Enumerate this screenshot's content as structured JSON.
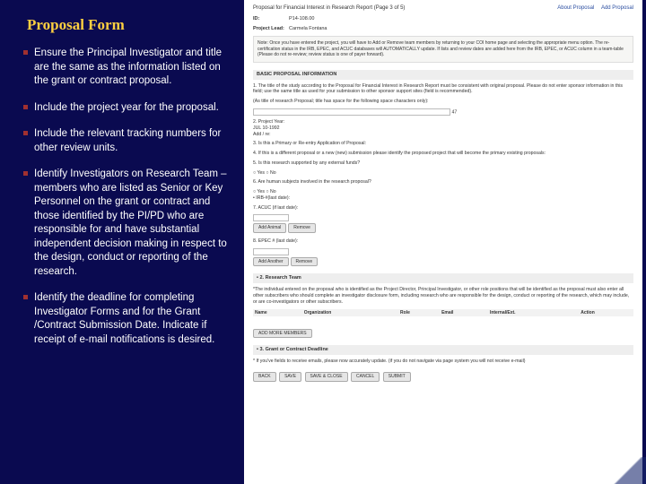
{
  "title": "Proposal Form",
  "bullets": [
    "Ensure the Principal Investigator and title are the same as the information listed on the grant or contract proposal.",
    "Include the project year for the proposal.",
    "Include the relevant tracking numbers for other review units.",
    "Identify Investigators on Research Team – members who are listed as Senior or Key Personnel on the grant or contract and those identified by the PI/PD who are responsible for and have substantial independent decision making in respect to the design, conduct or reporting of the research.",
    "Identify the deadline for completing Investigator Forms and for the Grant /Contract Submission Date. Indicate if receipt of e-mail notifications is desired."
  ],
  "form": {
    "page_title": "Proposal for Financial Interest in Research Report (Page 3 of 5)",
    "link_about": "About Proposal",
    "link_add": "Add Proposal",
    "id_label": "ID:",
    "id_value": "P14-108.00",
    "pi_label": "Project Lead:",
    "pi_value": "Carmela Fontana",
    "note": "Note: Once you have entered the project, you will have to Add or Remove team members by returning to your COI home page and selecting the appropriate menu option. The re-certification status in the IRB, EPEC, and ACUC databases will AUTOMATICALLY update. If lists and review dates are added here from the IRB, EPEC, or ACUC column in a team-table (Please do not re-review; review status is one of payer forward).",
    "box_basic": "BASIC PROPOSAL INFORMATION",
    "q1": "1. The title of the study according to the Proposal for Financial Interest in Research Report must be consistent with original proposal. Please do not enter sponsor information in this field; use the same title as used for your submission to other sponsor support sites (field is recommended).",
    "q1_hint": "(As title of research Proposal; title has space for the following space characters only):",
    "q2_label": "2. Project Year:",
    "q2_year": "JUL 10-1992",
    "q2_admin": "Add / re:",
    "q3": "3. Is this a Primary or Re-entry Application of Proposal:",
    "q4": "4. If this is a different proposal or a new (new) submission please identify the proposed project that will become the primary existing proposals:",
    "q5": "5. Is this research supported by any external funds?",
    "yes": "Yes",
    "no": "No",
    "q6": "6. Are human subjects involved in the research proposal?",
    "q7": "7. ACUC (if last date):",
    "btn_add_animal": "Add Animal",
    "btn_remove": "Remove",
    "q8": "8. EPEC # (last date):",
    "btn_add_another": "Add Another",
    "sec2_box": "• 2. Research Team",
    "sec2_text": "*The individual entered on the proposal who is identified as the Project Director, Principal Investigator, or other role positions that will be identified as the proposal must also enter all other subscribers who should complete an investigator disclosure form, including research who are responsible for the design, conduct or reporting of the research, which may include, or are co-investigators or other subscribers.",
    "cols": [
      "Name",
      "Organization",
      "Role",
      "Email",
      "Internal/Ext.",
      "Action"
    ],
    "btn_add_members": "ADD MORE MEMBERS",
    "sec3_box": "• 3. Grant or Contract Deadline",
    "sec3_text": "* If you've fields to receive emails, please now accurately update. (if you do not navigate via page system you will not receive e-mail)",
    "buttons": [
      "BACK",
      "SAVE",
      "SAVE & CLOSE",
      "CANCEL",
      "SUBMIT"
    ]
  }
}
